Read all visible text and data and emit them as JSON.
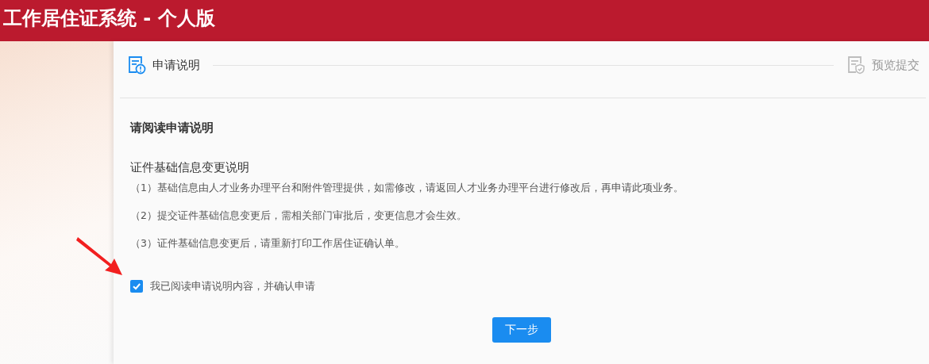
{
  "window": {
    "title": "工作居住证系统 - 个人版"
  },
  "steps": [
    {
      "label": "申请说明",
      "active": true
    },
    {
      "label": "预览提交",
      "active": false
    }
  ],
  "notice": {
    "heading": "请阅读申请说明",
    "subtitle": "证件基础信息变更说明",
    "items": [
      "（1）基础信息由人才业务办理平台和附件管理提供，如需修改，请返回人才业务办理平台进行修改后，再申请此项业务。",
      "（2）提交证件基础信息变更后，需相关部门审批后，变更信息才会生效。",
      "（3）证件基础信息变更后，请重新打印工作居住证确认单。"
    ]
  },
  "confirm": {
    "label": "我已阅读申请说明内容，并确认申请",
    "checked": true
  },
  "buttons": [
    {
      "label": "下一步"
    }
  ]
}
